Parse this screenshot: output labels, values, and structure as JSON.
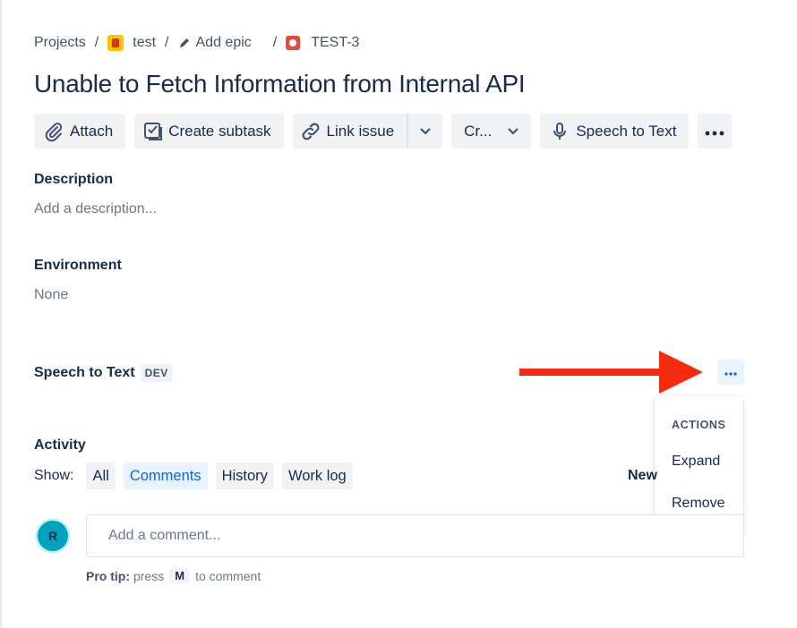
{
  "breadcrumbs": {
    "projects": "Projects",
    "project": "test",
    "add_epic": "Add epic",
    "issue_key": "TEST-3",
    "separator": "/"
  },
  "issue": {
    "title": "Unable to Fetch Information from Internal API"
  },
  "toolbar": {
    "attach": "Attach",
    "create_subtask": "Create subtask",
    "link_issue": "Link issue",
    "create": "Cr...",
    "speech_to_text": "Speech to Text"
  },
  "description": {
    "label": "Description",
    "placeholder": "Add a description..."
  },
  "environment": {
    "label": "Environment",
    "value": "None"
  },
  "speech_panel": {
    "label": "Speech to Text",
    "badge": "DEV"
  },
  "actions_menu": {
    "title": "ACTIONS",
    "items": [
      "Expand",
      "Remove"
    ]
  },
  "activity": {
    "label": "Activity",
    "show_label": "Show:",
    "filters": [
      "All",
      "Comments",
      "History",
      "Work log"
    ],
    "active_filter": "Comments",
    "sort_label": "New"
  },
  "comment": {
    "avatar_initial": "R",
    "placeholder": "Add a comment...",
    "protip_label": "Pro tip:",
    "protip_press": "press",
    "protip_key": "M",
    "protip_rest": "to comment"
  },
  "colors": {
    "accent": "#0c66e4",
    "annotation_arrow": "#f52a0f",
    "avatar": "#00a3bf"
  }
}
